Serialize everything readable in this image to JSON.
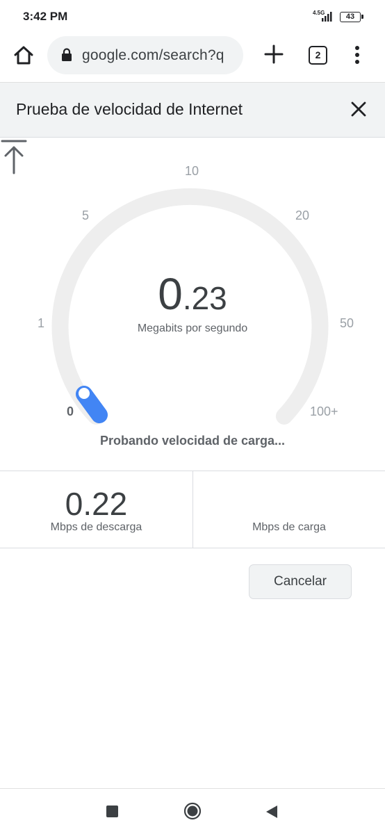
{
  "status_bar": {
    "time": "3:42 PM",
    "network": "4.5G",
    "battery": "43"
  },
  "toolbar": {
    "url": "google.com/search?q",
    "tab_count": "2",
    "icons": [
      "home-icon",
      "lock-icon",
      "plus-icon",
      "tabs-icon",
      "more-vert-icon"
    ]
  },
  "header": {
    "title": "Prueba de velocidad de Internet"
  },
  "gauge": {
    "ticks": [
      "0",
      "1",
      "5",
      "10",
      "20",
      "50",
      "100+"
    ],
    "value_int": "0",
    "value_dec": ".23",
    "unit": "Megabits por segundo",
    "status": "Probando velocidad de carga...",
    "colors": {
      "track": "#eeeeee",
      "progress": "#4285f4"
    }
  },
  "results": {
    "download_value": "0.22",
    "download_label": "Mbps de descarga",
    "upload_value": "",
    "upload_label": "Mbps de carga"
  },
  "actions": {
    "cancel_label": "Cancelar"
  }
}
